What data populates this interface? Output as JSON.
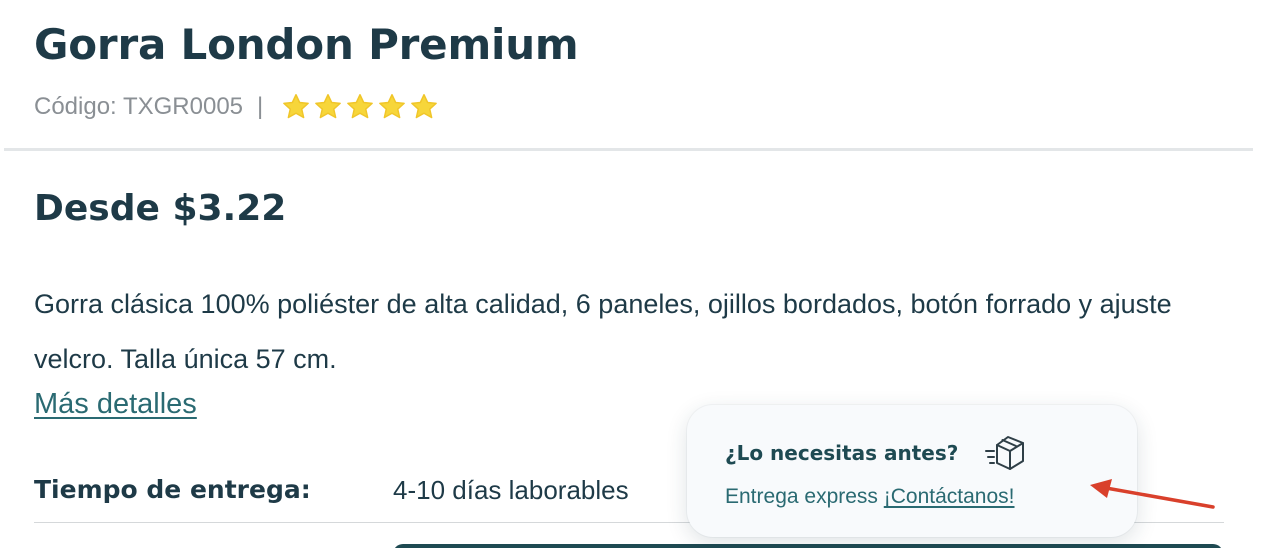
{
  "product": {
    "title": "Gorra London Premium",
    "sku": "Código: TXGR0005",
    "separator": "|",
    "rating": 5,
    "rating_max": 5,
    "star_color": "#f7d63a",
    "price": "Desde $3.22",
    "description": "Gorra clásica 100% poliéster de alta calidad, 6 paneles, ojillos bordados, botón forrado y ajuste velcro. Talla única 57 cm.",
    "details_link": "Más detalles"
  },
  "delivery": {
    "label": "Tiempo de entrega:",
    "value": "4-10 días laborables"
  },
  "express_popup": {
    "title": "¿Lo necesitas antes?",
    "icon": "fast-delivery-box-icon",
    "subtitle_prefix": "Entrega express ",
    "link_label": "¡Contáctanos!"
  },
  "annotation": {
    "arrow_color": "#d9402b"
  },
  "colors": {
    "text": "#1e3a47",
    "accent": "#2a6a72",
    "muted": "#8a8f94"
  }
}
